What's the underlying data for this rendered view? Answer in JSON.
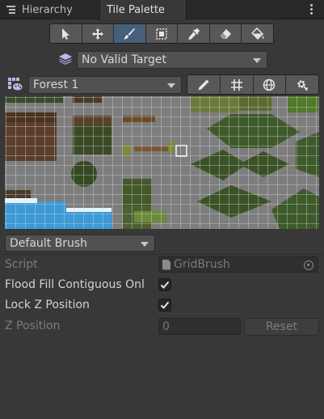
{
  "tabs": [
    {
      "label": "Hierarchy",
      "icon": "hierarchy-list-icon",
      "active": false
    },
    {
      "label": "Tile Palette",
      "active": true
    }
  ],
  "menu_icon": "kebab-menu-icon",
  "toolbar": {
    "tools": [
      {
        "name": "select",
        "icon": "select-arrow-icon",
        "active": false
      },
      {
        "name": "move",
        "icon": "move-icon",
        "active": false
      },
      {
        "name": "paint",
        "icon": "paintbrush-icon",
        "active": true
      },
      {
        "name": "box-fill",
        "icon": "box-fill-icon",
        "active": false
      },
      {
        "name": "picker",
        "icon": "eyedropper-icon",
        "active": false
      },
      {
        "name": "erase",
        "icon": "eraser-icon",
        "active": false
      },
      {
        "name": "fill",
        "icon": "paint-bucket-icon",
        "active": false
      }
    ]
  },
  "active_target": {
    "value": "No Valid Target",
    "icon": "layers-icon"
  },
  "palette": {
    "value": "Forest 1",
    "icon": "palette-icon"
  },
  "palette_tools": [
    {
      "name": "edit",
      "icon": "pencil-icon"
    },
    {
      "name": "grid",
      "icon": "grid-icon"
    },
    {
      "name": "gizmos",
      "icon": "globe-icon"
    },
    {
      "name": "settings",
      "icon": "gear-icon"
    }
  ],
  "brush": {
    "value": "Default Brush"
  },
  "properties": {
    "script_label": "Script",
    "script_value": "GridBrush",
    "flood_fill_label": "Flood Fill Contiguous Onl",
    "flood_fill_checked": true,
    "lock_z_label": "Lock Z Position",
    "lock_z_checked": true,
    "z_position_label": "Z Position",
    "z_position_value": "0",
    "reset_label": "Reset"
  },
  "colors": {
    "panel_bg": "#383838",
    "active_tool": "#46607c",
    "grid_bg": "#7d7d7d",
    "water": "#3c9ad6",
    "foliage": "#3e5a2a",
    "soil": "#5b3f2a"
  }
}
